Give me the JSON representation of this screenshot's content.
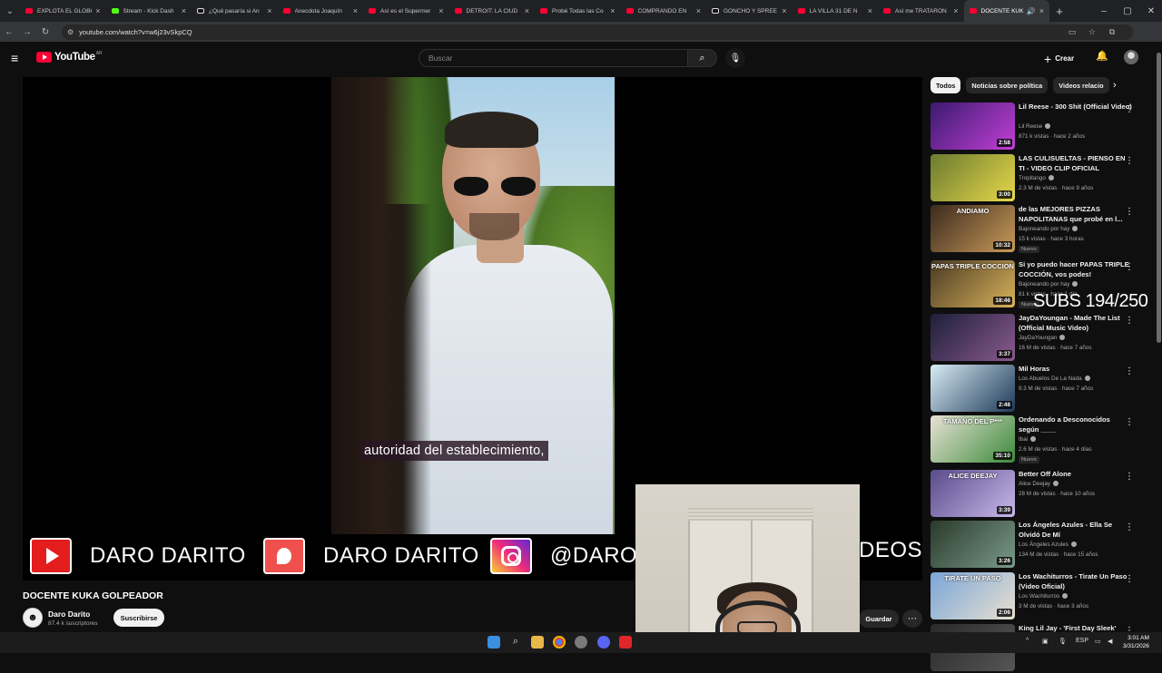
{
  "browser": {
    "tabs": [
      {
        "label": "EXPLOTA EL GLOBO",
        "icon": "youtube"
      },
      {
        "label": "Stream - Kick Dash",
        "icon": "kick"
      },
      {
        "label": "¿Qué pasaría si An",
        "icon": "tiktok"
      },
      {
        "label": "Anecdota Joaquín",
        "icon": "youtube"
      },
      {
        "label": "Así es el Supermer",
        "icon": "youtube"
      },
      {
        "label": "DETROIT: LA CIUD",
        "icon": "youtube"
      },
      {
        "label": "Probé Todas las Co",
        "icon": "youtube"
      },
      {
        "label": "COMPRANDO EN",
        "icon": "youtube"
      },
      {
        "label": "GONCHO Y SPREE",
        "icon": "tiktok"
      },
      {
        "label": "LA VILLA 31 DE N",
        "icon": "youtube"
      },
      {
        "label": "Así me TRATARON",
        "icon": "youtube"
      },
      {
        "label": "DOCENTE KUK",
        "icon": "youtube",
        "active": true,
        "audio": true
      }
    ],
    "url": "youtube.com/watch?v=w6j23vSkpCQ"
  },
  "youtube": {
    "logo_text": "YouTube",
    "country_code": "AR",
    "search_placeholder": "Buscar",
    "create_label": "Crear"
  },
  "player": {
    "subtitle": "autoridad del establecimiento,",
    "banner": [
      {
        "network": "youtube",
        "text": "DARO DARITO"
      },
      {
        "network": "patreon",
        "text": "DARO DARITO"
      },
      {
        "network": "instagram",
        "text": "@DARO"
      }
    ],
    "banner_tail": "DEOS"
  },
  "video": {
    "title": "DOCENTE KUKA GOLPEADOR",
    "channel": "Daro Darito",
    "subscribers": "87.4 k suscriptores",
    "subscribe_label": "Suscribirse",
    "save_label": "Guardar"
  },
  "chips": [
    "Todos",
    "Noticias sobre política",
    "Videos relacio"
  ],
  "recommendations": [
    {
      "title": "Lil Reese - 300 Shit (Official Video)",
      "channel": "Lil Reese",
      "verified": true,
      "meta": "871 k vistas · hace 2 años",
      "duration": "2:58",
      "colors": [
        "#3a1a6e",
        "#c23fd6"
      ]
    },
    {
      "title": "LAS CULISUELTAS - PIENSO EN TI - VIDEO CLIP OFICIAL",
      "channel": "Tropitango",
      "verified": true,
      "meta": "2.3 M de vistas · hace 9 años",
      "duration": "3:00",
      "colors": [
        "#6a7a30",
        "#e8d84a"
      ]
    },
    {
      "title": "de las MEJORES PIZZAS NAPOLITANAS que probé en l...",
      "channel": "Bajoneando por hay",
      "verified": true,
      "meta": "15 k vistas · hace 3 horas",
      "duration": "10:32",
      "badge": "Nuevo",
      "colors": [
        "#3b2a1c",
        "#c99a5b"
      ],
      "thumb_text": "ANDIAMO"
    },
    {
      "title": "Si yo puedo hacer PAPAS TRIPLE COCCIÓN, vos podes!",
      "channel": "Bajoneando por hay",
      "verified": true,
      "meta": "81 k vistas · hace 1 día",
      "duration": "18:46",
      "badge": "Nuevo",
      "colors": [
        "#4a3a24",
        "#d9b25a"
      ],
      "thumb_text": "PAPAS TRIPLE COCCION"
    },
    {
      "title": "JayDaYoungan - Made The List (Official Music Video)",
      "channel": "JayDaYoungan",
      "verified": true,
      "meta": "16 M de vistas · hace 7 años",
      "duration": "3:37",
      "colors": [
        "#1d1f3a",
        "#8a5a8e"
      ]
    },
    {
      "title": "Mil Horas",
      "channel": "Los Abuelos De La Nada",
      "verified": true,
      "meta": "9.3 M de vistas · hace 7 años",
      "duration": "2:48",
      "colors": [
        "#d8ecf4",
        "#1f3a5a"
      ]
    },
    {
      "title": "Ordenando a Desconocidos según ____",
      "channel": "Ibai",
      "verified": true,
      "meta": "2.6 M de vistas · hace 4 días",
      "duration": "35:10",
      "badge": "Nuevo",
      "colors": [
        "#e9e2d6",
        "#3b8a3a"
      ],
      "thumb_text": "TAMAÑO DEL P***"
    },
    {
      "title": "Better Off Alone",
      "channel": "Alice Deejay",
      "verified": true,
      "meta": "28 M de vistas · hace 10 años",
      "duration": "3:39",
      "colors": [
        "#5a4a8a",
        "#c8b8ea"
      ],
      "thumb_text": "ALICE DEEJAY"
    },
    {
      "title": "Los Ángeles Azules - Ella Se Olvidó De Mí",
      "channel": "Los Ángeles Azules",
      "verified": true,
      "meta": "134 M de vistas · hace 15 años",
      "duration": "3:26",
      "colors": [
        "#2a3a2a",
        "#7a9a8a"
      ]
    },
    {
      "title": "Los Wachiturros - Tirate Un Paso (Video Oficial)",
      "channel": "Los Wachiturros",
      "verified": true,
      "meta": "3 M de vistas · hace 3 años",
      "duration": "2:06",
      "colors": [
        "#7aa6d8",
        "#e8e0d0"
      ],
      "thumb_text": "TIRATE UN PASO"
    },
    {
      "title": "King Lil Jay - 'First Day Sleek'",
      "channel": "",
      "verified": false,
      "meta": "",
      "duration": "",
      "colors": [
        "#2a2a2a",
        "#555555"
      ]
    }
  ],
  "overlay_text": "SUBS 194/250",
  "taskbar": {
    "lang": "ESP",
    "time": "3:01 AM",
    "date": "3/31/2026"
  }
}
